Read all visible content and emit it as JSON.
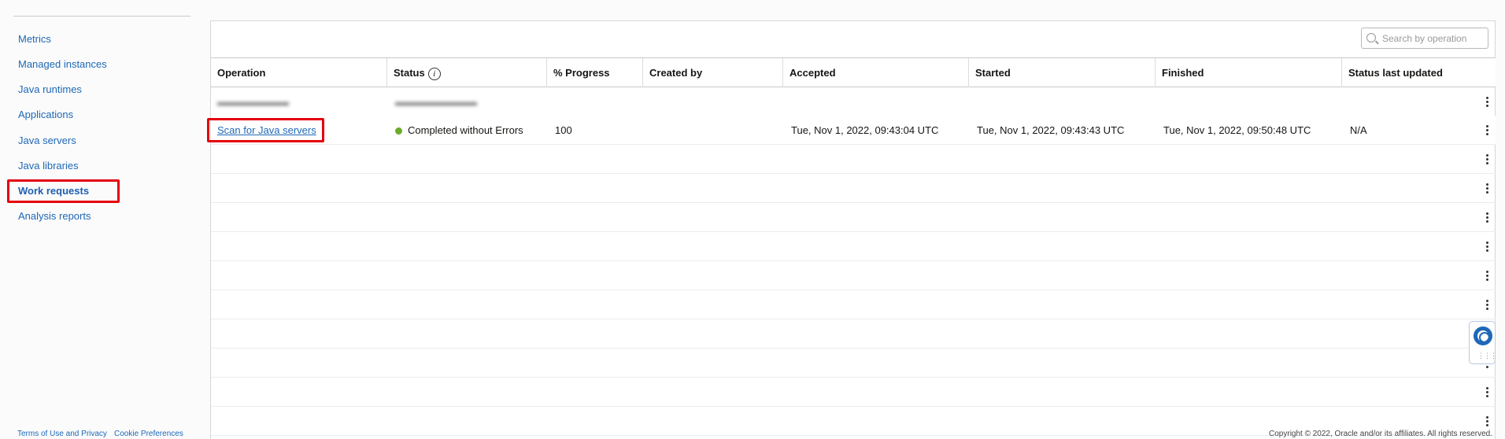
{
  "sidebar": {
    "items": [
      {
        "label": "Metrics"
      },
      {
        "label": "Managed instances"
      },
      {
        "label": "Java runtimes"
      },
      {
        "label": "Applications"
      },
      {
        "label": "Java servers"
      },
      {
        "label": "Java libraries"
      },
      {
        "label": "Work requests",
        "active": true
      },
      {
        "label": "Analysis reports"
      }
    ]
  },
  "search": {
    "placeholder": "Search by operation"
  },
  "table": {
    "columns": [
      "Operation",
      "Status",
      "% Progress",
      "Created by",
      "Accepted",
      "Started",
      "Finished",
      "Status last updated"
    ],
    "highlighted_row": {
      "operation": "Scan for Java servers",
      "status": "Completed without Errors",
      "progress": "100",
      "accepted": "Tue, Nov 1, 2022, 09:43:04 UTC",
      "started": "Tue, Nov 1, 2022, 09:43:43 UTC",
      "finished": "Tue, Nov 1, 2022, 09:50:48 UTC",
      "status_last_updated": "N/A"
    }
  },
  "footer": {
    "terms": "Terms of Use and Privacy",
    "cookies": "Cookie Preferences",
    "copyright": "Copyright © 2022, Oracle and/or its affiliates. All rights reserved."
  },
  "colors": {
    "accent": "#1e68b7",
    "highlight": "#e5000e",
    "success": "#6cab2a"
  }
}
